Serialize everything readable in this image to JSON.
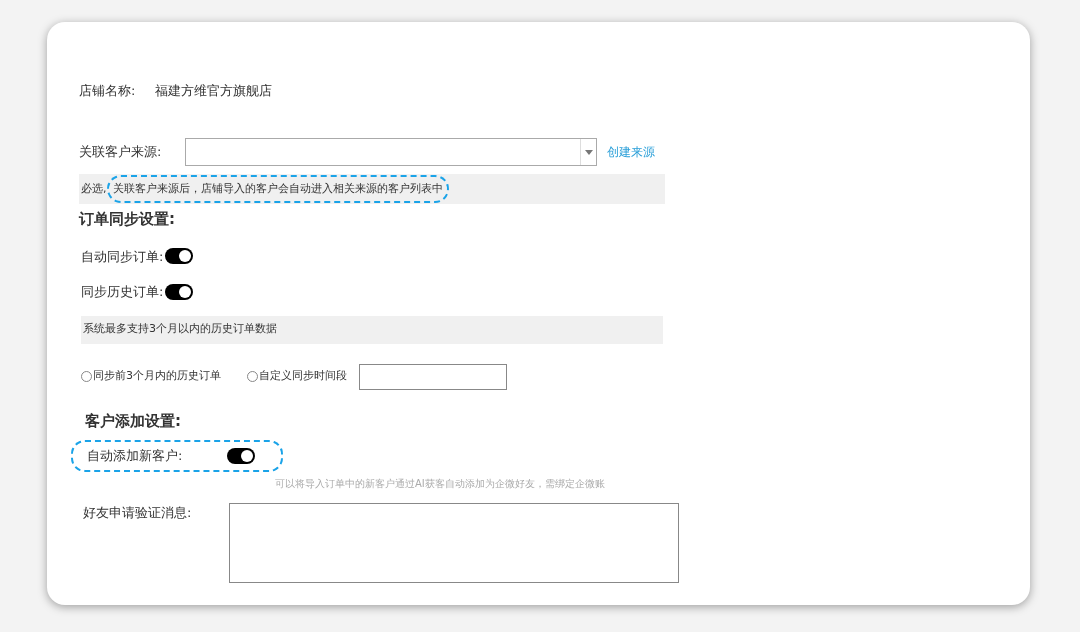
{
  "store": {
    "label": "店铺名称:",
    "value": "福建方维官方旗舰店"
  },
  "source": {
    "label": "关联客户来源:",
    "link": "创建来源",
    "hint_prefix": "必选,",
    "hint": "关联客户来源后，店铺导入的客户会自动进入相关来源的客户列表中",
    "highlighted": true
  },
  "order_sync": {
    "title": "订单同步设置:",
    "toggles": [
      {
        "label": "自动同步订单:",
        "on": true
      },
      {
        "label": "同步历史订单:",
        "on": true
      }
    ],
    "note": "系统最多支持3个月以内的历史订单数据",
    "radios": [
      {
        "label": "同步前3个月内的历史订单",
        "selected": false
      },
      {
        "label": "自定义同步时间段",
        "selected": false
      }
    ]
  },
  "customer_add": {
    "title": "客户添加设置:",
    "toggle": {
      "label": "自动添加新客户:",
      "on": true,
      "highlighted": true
    },
    "hint": "可以将导入订单中的新客户通过AI获客自动添加为企微好友，需绑定企微账",
    "message_label": "好友申请验证消息:"
  }
}
